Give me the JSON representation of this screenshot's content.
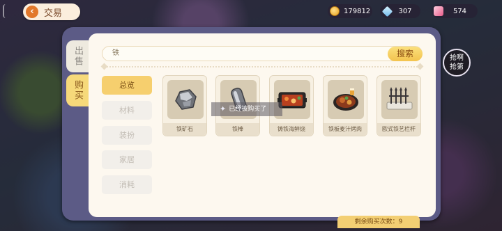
{
  "header": {
    "title": "交易"
  },
  "resources": [
    {
      "name": "coin",
      "icon": "coin-icon",
      "value": "179812"
    },
    {
      "name": "gem",
      "icon": "diamond-icon",
      "value": "307"
    },
    {
      "name": "ruby",
      "icon": "ruby-icon",
      "value": "574"
    }
  ],
  "tabs": {
    "sell": "出售",
    "buy": "购买"
  },
  "search": {
    "query": "铁",
    "button": "搜索"
  },
  "categories": [
    "总览",
    "材料",
    "装扮",
    "家居",
    "消耗"
  ],
  "items": [
    {
      "name": "铁矿石",
      "icon": "iron-ore-icon"
    },
    {
      "name": "铁棒",
      "icon": "iron-bar-icon"
    },
    {
      "name": "铸铁海鲜烧",
      "icon": "seafood-grill-icon"
    },
    {
      "name": "铁板麦汁烤肉",
      "icon": "grilled-meat-icon"
    },
    {
      "name": "欧式铁艺栏杆",
      "icon": "iron-railing-icon"
    }
  ],
  "toast": {
    "text": "已经被购买了"
  },
  "grab_button": {
    "label": "抢啊抢第"
  },
  "footer": {
    "remaining_text": "剩余购买次数：9"
  },
  "colors": {
    "panel": "#5c5b86",
    "accent": "#f6cf6e",
    "card": "#f7f0e2"
  }
}
